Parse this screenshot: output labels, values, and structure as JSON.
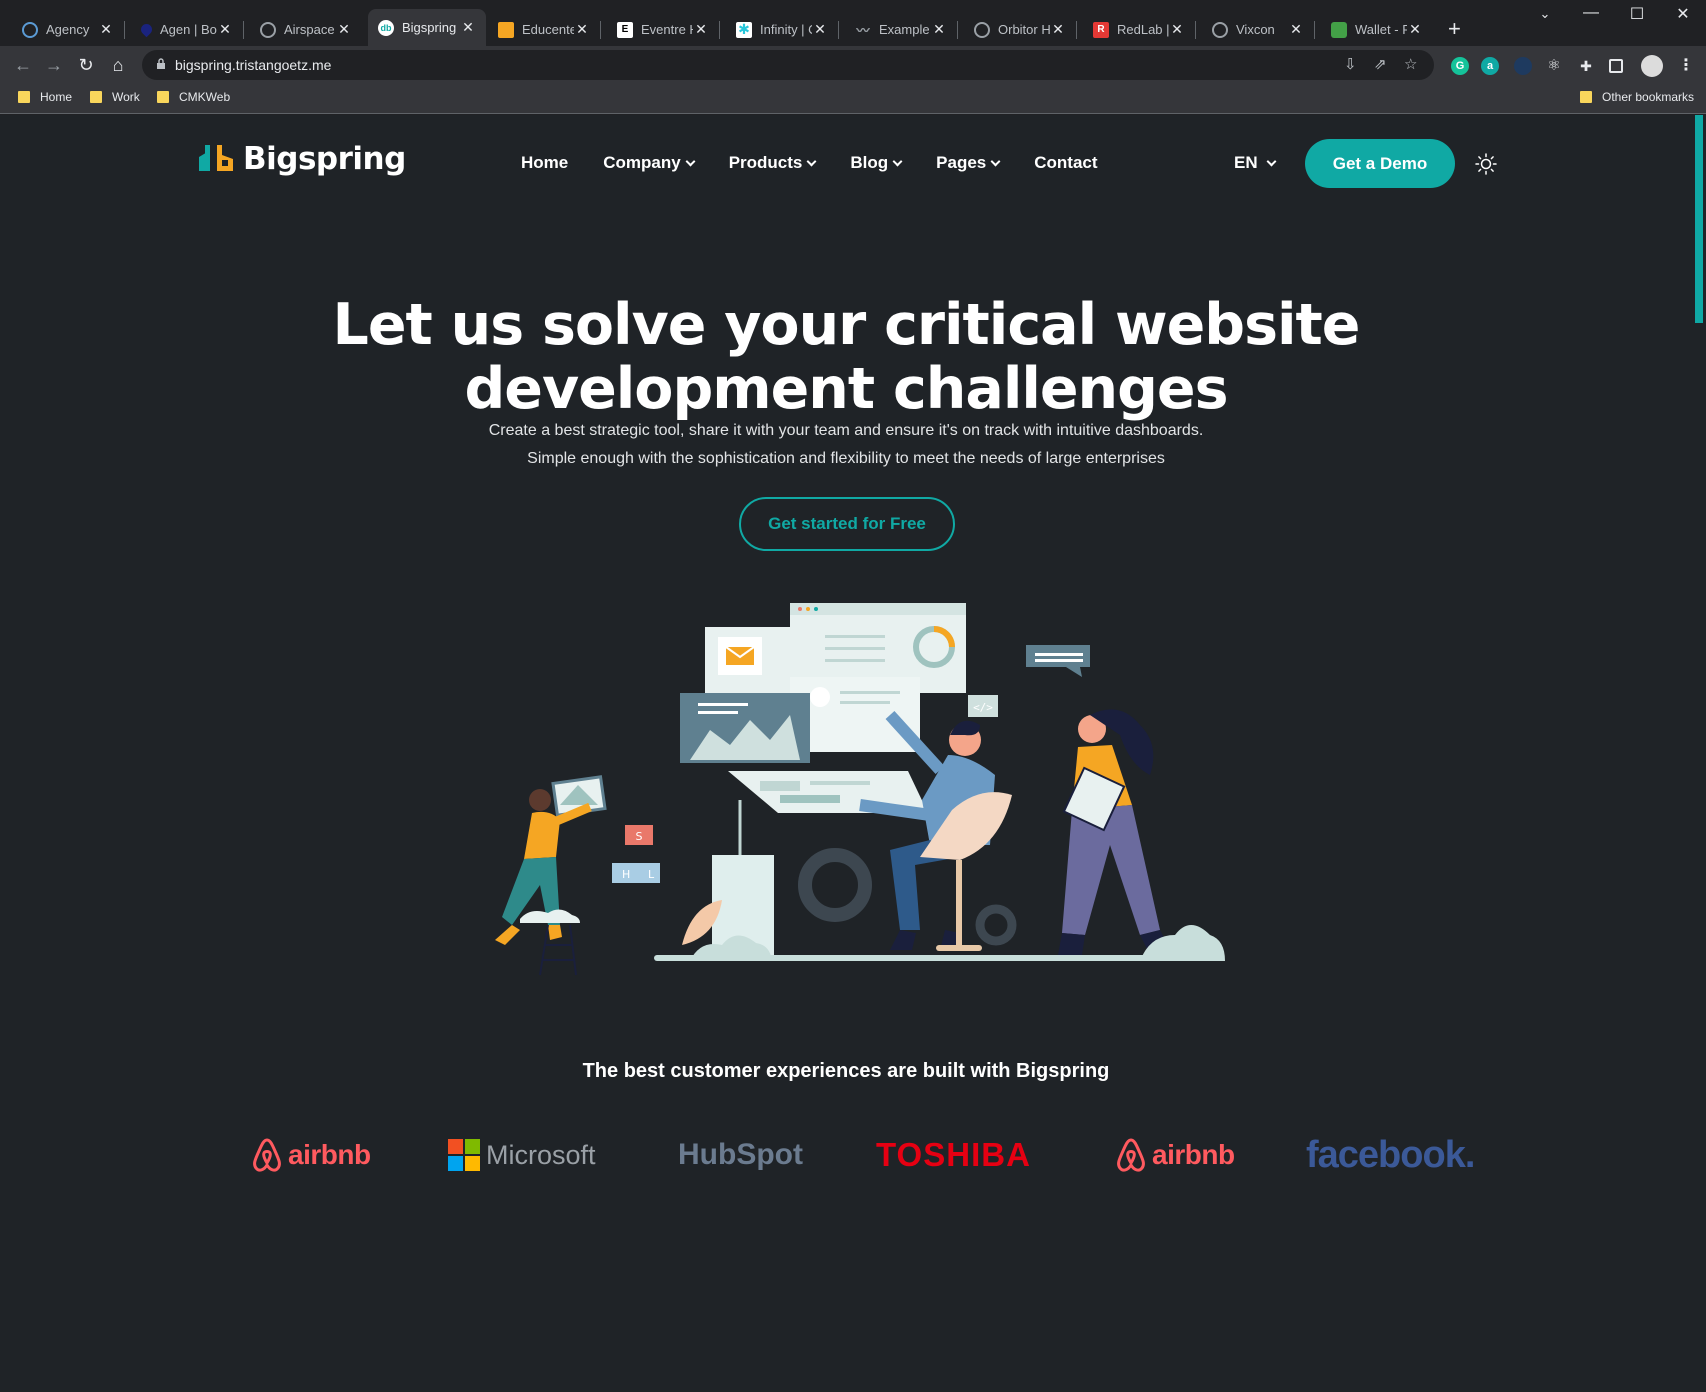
{
  "browser": {
    "tabs": [
      {
        "title": "Agency",
        "icon": "agency-icon",
        "color": "#5b9bd5"
      },
      {
        "title": "Agen | Bo",
        "icon": "map-pin-icon",
        "color": "#1a237e"
      },
      {
        "title": "Airspace |",
        "icon": "globe-icon",
        "color": "#9aa0a6"
      },
      {
        "title": "Bigspring",
        "icon": "bigspring-icon",
        "color": "#10a9a4"
      },
      {
        "title": "Educenter",
        "icon": "cube-icon",
        "color": "#f5a623"
      },
      {
        "title": "Eventre H",
        "icon": "e-icon",
        "color": "#ffffff"
      },
      {
        "title": "Infinity | C",
        "icon": "asterisk-icon",
        "color": "#26c6da"
      },
      {
        "title": "Example s",
        "icon": "pulse-icon",
        "color": "#9aa0a6"
      },
      {
        "title": "Orbitor H",
        "icon": "globe-icon",
        "color": "#9aa0a6"
      },
      {
        "title": "RedLab | F",
        "icon": "r-icon",
        "color": "#e53935"
      },
      {
        "title": "Vixcon",
        "icon": "globe-icon",
        "color": "#9aa0a6"
      },
      {
        "title": "Wallet - P",
        "icon": "wallet-icon",
        "color": "#43a047"
      }
    ],
    "url": "bigspring.tristangoetz.me",
    "bookmarks": [
      {
        "label": "Home"
      },
      {
        "label": "Work"
      },
      {
        "label": "CMKWeb"
      }
    ],
    "other_bookmarks": "Other bookmarks"
  },
  "site": {
    "logo_text": "Bigspring",
    "nav": [
      {
        "label": "Home",
        "dropdown": false
      },
      {
        "label": "Company",
        "dropdown": true
      },
      {
        "label": "Products",
        "dropdown": true
      },
      {
        "label": "Blog",
        "dropdown": true
      },
      {
        "label": "Pages",
        "dropdown": true
      },
      {
        "label": "Contact",
        "dropdown": false
      }
    ],
    "language": "EN",
    "demo_button": "Get a Demo",
    "accent_color": "#10a9a4",
    "hero": {
      "title_line1": "Let us solve your critical website",
      "title_line2": "development challenges",
      "subtitle_line1": "Create a best strategic tool, share it with your team and ensure it's on track with intuitive dashboards.",
      "subtitle_line2": "Simple enough with the sophistication and flexibility to meet the needs of large enterprises",
      "cta": "Get started for Free"
    },
    "trusted_heading": "The best customer experiences are built with Bigspring",
    "brands": [
      {
        "name": "airbnb",
        "color": "#ff5a5f"
      },
      {
        "name": "Microsoft",
        "color": "#9aa0a6"
      },
      {
        "name": "HubSpot",
        "color": "#6b7b8f"
      },
      {
        "name": "TOSHIBA",
        "color": "#e60012"
      },
      {
        "name": "airbnb",
        "color": "#ff5a5f"
      },
      {
        "name": "facebook.",
        "color": "#3b5998"
      }
    ]
  }
}
